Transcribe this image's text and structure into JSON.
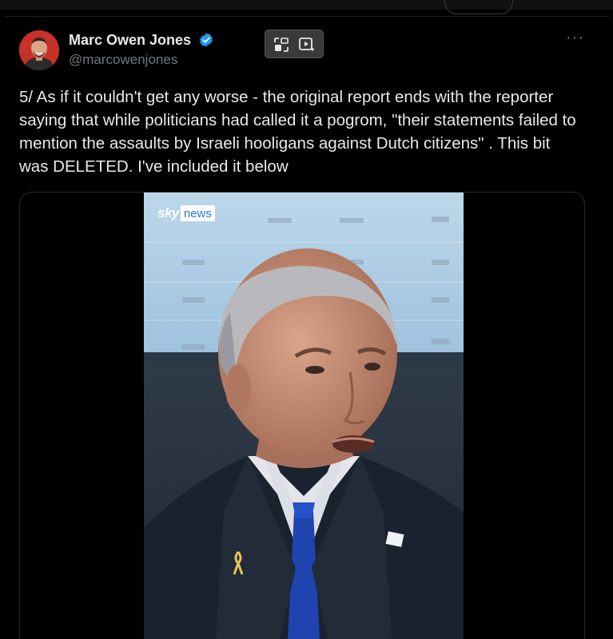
{
  "post": {
    "author_name": "Marc Owen Jones",
    "handle": "@marcowenjones",
    "more_label": "···",
    "text": "5/ As if it couldn't get any worse -  the original report ends with the reporter saying that while politicians had called it a pogrom, \"their statements failed to mention the assaults by Israeli hooligans against Dutch citizens\" . This bit was DELETED. I've included it below"
  },
  "media": {
    "logo_sky": "sky",
    "logo_news": "news"
  },
  "colors": {
    "background": "#000000",
    "text": "#e7e9ea",
    "secondary_text": "#71767b",
    "verified_badge": "#1d9bf0",
    "chip_background": "#3a3a3a"
  },
  "icons": [
    "verified-badge-icon",
    "picture-in-picture-icon",
    "video-sparkle-icon",
    "more-options-icon"
  ]
}
